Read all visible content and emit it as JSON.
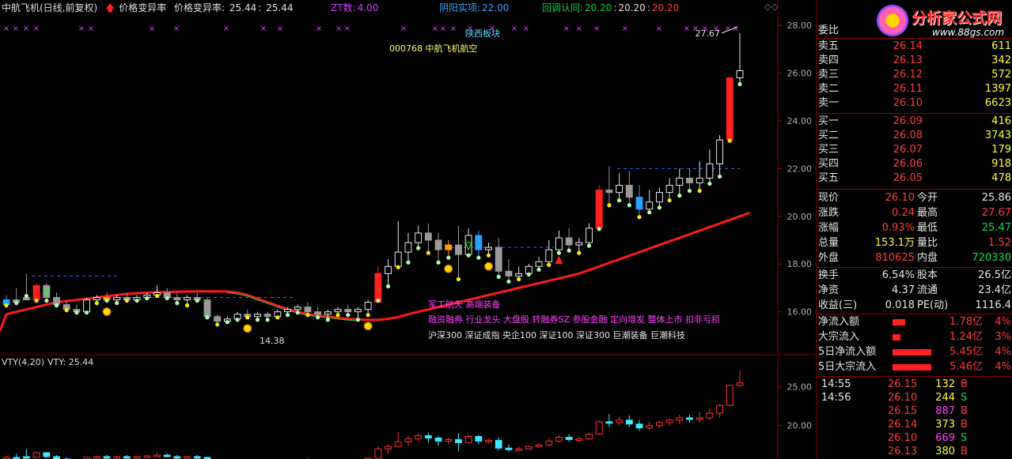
{
  "header": {
    "title": "中航飞机(日线,前复权)",
    "ind1_name": "价格变异率",
    "ind1_label": "价格变异率:",
    "ind1_v1": "25.44",
    "ind1_v2": "25.44",
    "zt_label": "ZT数:",
    "zt_value": "4.00",
    "yy_label": "阴阳实项:",
    "yy_value": "22.00",
    "hd_label": "回调认同:",
    "hd_v1": "20.20",
    "hd_v2": "20.20",
    "hd_v3": "20.20"
  },
  "overlay": {
    "sector": "陕西板块",
    "stock": "000768 中航飞机航空",
    "peak_label": "27.67",
    "low_label": "14.38",
    "concepts_1": "军工航天 高端装备",
    "concepts_2": "融资融券 行业龙头 大盘股 转融券SZ 参股金融 定向增发 整体上市 扣非亏损",
    "concepts_3": "沪深300 深证成指 央企100 深证100 深证300 巨潮装备 巨潮科技"
  },
  "axis": {
    "main_ticks": [
      "28.00",
      "26.00",
      "24.00",
      "22.00",
      "20.00",
      "18.00",
      "16.00"
    ],
    "sub_ticks": [
      "25.00",
      "20.00"
    ]
  },
  "sub": {
    "label": "VTY(4,20)",
    "value_label": "VTY: 25.44"
  },
  "logo": {
    "brand": "分析家公式网",
    "url": "www.88gs.com"
  },
  "orderbook": {
    "header": "委比",
    "asks": [
      {
        "label": "卖五",
        "price": "26.14",
        "vol": "611"
      },
      {
        "label": "卖四",
        "price": "26.13",
        "vol": "342"
      },
      {
        "label": "卖三",
        "price": "26.12",
        "vol": "572"
      },
      {
        "label": "卖二",
        "price": "26.11",
        "vol": "1397"
      },
      {
        "label": "卖一",
        "price": "26.10",
        "vol": "6623"
      }
    ],
    "bids": [
      {
        "label": "买一",
        "price": "26.09",
        "vol": "416"
      },
      {
        "label": "买二",
        "price": "26.08",
        "vol": "3743"
      },
      {
        "label": "买三",
        "price": "26.07",
        "vol": "179"
      },
      {
        "label": "买四",
        "price": "26.06",
        "vol": "918"
      },
      {
        "label": "买五",
        "price": "26.05",
        "vol": "478"
      }
    ]
  },
  "quote": [
    {
      "l1": "现价",
      "v1": "26.10",
      "l2": "今开",
      "v2": "25.86",
      "c1": "red",
      "c2": "white"
    },
    {
      "l1": "涨跌",
      "v1": "0.24",
      "l2": "最高",
      "v2": "27.67",
      "c1": "red",
      "c2": "red"
    },
    {
      "l1": "涨幅",
      "v1": "0.93%",
      "l2": "最低",
      "v2": "25.47",
      "c1": "red",
      "c2": "green"
    },
    {
      "l1": "总量",
      "v1": "153.1万",
      "l2": "量比",
      "v2": "1.52",
      "c1": "yellow",
      "c2": "red"
    },
    {
      "l1": "外盘",
      "v1": "810625",
      "l2": "内盘",
      "v2": "720330",
      "c1": "red",
      "c2": "green"
    }
  ],
  "fund": [
    {
      "l1": "换手",
      "v1": "6.54%",
      "l2": "股本",
      "v2": "26.5亿"
    },
    {
      "l1": "净资",
      "v1": "4.37",
      "l2": "流通",
      "v2": "23.4亿"
    },
    {
      "l1": "收益(三)",
      "v1": "0.018",
      "l2": "PE(动)",
      "v2": "1116.4"
    }
  ],
  "flow": [
    {
      "label": "净流入额",
      "val": "1.78亿",
      "pct": "4%",
      "bar": 0.3
    },
    {
      "label": "大宗流入",
      "val": "1.24亿",
      "pct": "3%",
      "bar": 0.2
    },
    {
      "label": "5日净流入额",
      "val": "5.45亿",
      "pct": "4%",
      "bar": 0.95
    },
    {
      "label": "5日大宗流入",
      "val": "5.46亿",
      "pct": "4%",
      "bar": 0.95
    }
  ],
  "ticks": [
    {
      "time": "14:55",
      "price": "26.15",
      "vol": "132",
      "side": "B",
      "vc": "yellow"
    },
    {
      "time": "14:56",
      "price": "26.10",
      "vol": "244",
      "side": "S",
      "vc": "yellow"
    },
    {
      "time": "",
      "price": "26.15",
      "vol": "887",
      "side": "B",
      "vc": "mag"
    },
    {
      "time": "",
      "price": "26.14",
      "vol": "373",
      "side": "B",
      "vc": "yellow"
    },
    {
      "time": "",
      "price": "26.10",
      "vol": "669",
      "side": "S",
      "vc": "mag"
    },
    {
      "time": "",
      "price": "26.13",
      "vol": "380",
      "side": "B",
      "vc": "yellow"
    }
  ],
  "chart_data": {
    "type": "candlestick",
    "ylim": [
      14.5,
      28.4
    ],
    "ma": [
      15.9,
      16.0,
      16.1,
      16.2,
      16.3,
      16.4,
      16.45,
      16.5,
      16.55,
      16.6,
      16.65,
      16.7,
      16.75,
      16.78,
      16.8,
      16.82,
      16.83,
      16.84,
      16.85,
      16.86,
      16.86,
      16.86,
      16.85,
      16.8,
      16.7,
      16.55,
      16.4,
      16.25,
      16.1,
      16.0,
      15.9,
      15.85,
      15.8,
      15.75,
      15.7,
      15.68,
      15.66,
      15.66,
      15.7,
      15.78,
      15.9,
      16.0,
      16.1,
      16.2,
      16.3,
      16.4,
      16.5,
      16.6,
      16.7,
      16.8,
      16.9,
      17.0,
      17.1,
      17.2,
      17.3,
      17.4,
      17.5,
      17.6,
      17.75,
      17.9,
      18.05,
      18.2,
      18.35,
      18.5,
      18.65,
      18.8,
      18.95,
      19.1,
      19.25,
      19.4,
      19.55,
      19.7,
      19.85,
      20.0,
      20.15
    ],
    "candles": [
      [
        16.3,
        16.7,
        16.5,
        16.2
      ],
      [
        16.5,
        17.0,
        16.4,
        16.3
      ],
      [
        16.6,
        17.6,
        16.5,
        16.6
      ],
      [
        16.5,
        17.2,
        17.1,
        16.4
      ],
      [
        17.1,
        17.2,
        16.6,
        16.4
      ],
      [
        16.6,
        16.8,
        16.3,
        16.2
      ],
      [
        16.3,
        16.5,
        16.1,
        16.0
      ],
      [
        16.1,
        16.3,
        16.0,
        15.9
      ],
      [
        16.0,
        16.6,
        16.5,
        15.9
      ],
      [
        16.5,
        16.7,
        16.6,
        16.3
      ],
      [
        16.6,
        16.8,
        16.5,
        16.4
      ],
      [
        16.5,
        16.7,
        16.6,
        16.3
      ],
      [
        16.6,
        16.8,
        16.5,
        16.4
      ],
      [
        16.5,
        16.7,
        16.6,
        16.4
      ],
      [
        16.6,
        16.8,
        16.7,
        16.5
      ],
      [
        16.7,
        17.1,
        16.8,
        16.6
      ],
      [
        16.8,
        17.0,
        16.6,
        16.5
      ],
      [
        16.6,
        16.8,
        16.5,
        16.3
      ],
      [
        16.5,
        16.7,
        16.6,
        16.2
      ],
      [
        16.6,
        16.8,
        16.5,
        16.4
      ],
      [
        16.5,
        16.6,
        15.8,
        15.7
      ],
      [
        15.8,
        15.9,
        15.6,
        15.4
      ],
      [
        15.6,
        15.8,
        15.7,
        15.5
      ],
      [
        15.7,
        16.0,
        15.9,
        15.6
      ],
      [
        15.9,
        16.1,
        15.8,
        15.7
      ],
      [
        15.8,
        16.0,
        15.9,
        15.6
      ],
      [
        15.9,
        16.0,
        15.8,
        15.6
      ],
      [
        15.8,
        16.1,
        16.0,
        15.7
      ],
      [
        16.0,
        16.2,
        16.1,
        15.8
      ],
      [
        16.1,
        16.3,
        16.2,
        15.9
      ],
      [
        16.2,
        16.4,
        16.0,
        15.8
      ],
      [
        16.0,
        16.2,
        15.9,
        15.7
      ],
      [
        15.9,
        16.1,
        16.0,
        15.6
      ],
      [
        16.0,
        16.2,
        16.1,
        15.8
      ],
      [
        16.1,
        16.3,
        16.0,
        15.8
      ],
      [
        16.0,
        16.2,
        16.1,
        15.6
      ],
      [
        16.1,
        16.5,
        16.4,
        15.8
      ],
      [
        16.4,
        17.9,
        17.6,
        16.4
      ],
      [
        17.6,
        18.2,
        17.9,
        17.0
      ],
      [
        17.9,
        19.8,
        18.5,
        17.8
      ],
      [
        18.5,
        19.3,
        18.9,
        18.0
      ],
      [
        18.9,
        19.6,
        19.3,
        18.6
      ],
      [
        19.3,
        19.7,
        19.0,
        18.4
      ],
      [
        19.0,
        19.3,
        18.6,
        18.0
      ],
      [
        18.6,
        19.0,
        18.8,
        18.2
      ],
      [
        18.8,
        19.6,
        18.4,
        17.3
      ],
      [
        18.4,
        19.5,
        19.2,
        18.3
      ],
      [
        19.2,
        19.4,
        18.6,
        18.2
      ],
      [
        18.6,
        18.9,
        18.7,
        18.3
      ],
      [
        18.7,
        19.1,
        17.7,
        17.4
      ],
      [
        17.7,
        18.2,
        17.5,
        17.2
      ],
      [
        17.5,
        17.9,
        17.6,
        17.3
      ],
      [
        17.6,
        18.0,
        17.9,
        17.5
      ],
      [
        17.9,
        18.3,
        18.1,
        17.7
      ],
      [
        18.1,
        19.0,
        18.6,
        17.9
      ],
      [
        18.6,
        19.4,
        19.1,
        18.4
      ],
      [
        19.1,
        19.5,
        18.8,
        18.5
      ],
      [
        18.8,
        19.1,
        18.9,
        18.4
      ],
      [
        18.9,
        19.7,
        19.5,
        18.7
      ],
      [
        19.5,
        21.3,
        21.1,
        19.4
      ],
      [
        21.1,
        22.1,
        21.0,
        20.4
      ],
      [
        21.0,
        21.8,
        21.3,
        20.6
      ],
      [
        21.3,
        21.9,
        20.8,
        20.4
      ],
      [
        20.8,
        21.3,
        20.3,
        19.9
      ],
      [
        20.3,
        21.1,
        20.6,
        20.1
      ],
      [
        20.6,
        21.2,
        21.0,
        20.3
      ],
      [
        21.0,
        21.6,
        21.3,
        20.6
      ],
      [
        21.3,
        22.0,
        21.6,
        20.8
      ],
      [
        21.6,
        22.0,
        21.4,
        21.0
      ],
      [
        21.4,
        22.3,
        21.6,
        21.0
      ],
      [
        21.6,
        22.8,
        22.2,
        21.3
      ],
      [
        22.2,
        23.4,
        23.2,
        21.6
      ],
      [
        23.2,
        25.8,
        25.8,
        23.1
      ],
      [
        25.8,
        27.67,
        26.1,
        25.47
      ]
    ]
  }
}
